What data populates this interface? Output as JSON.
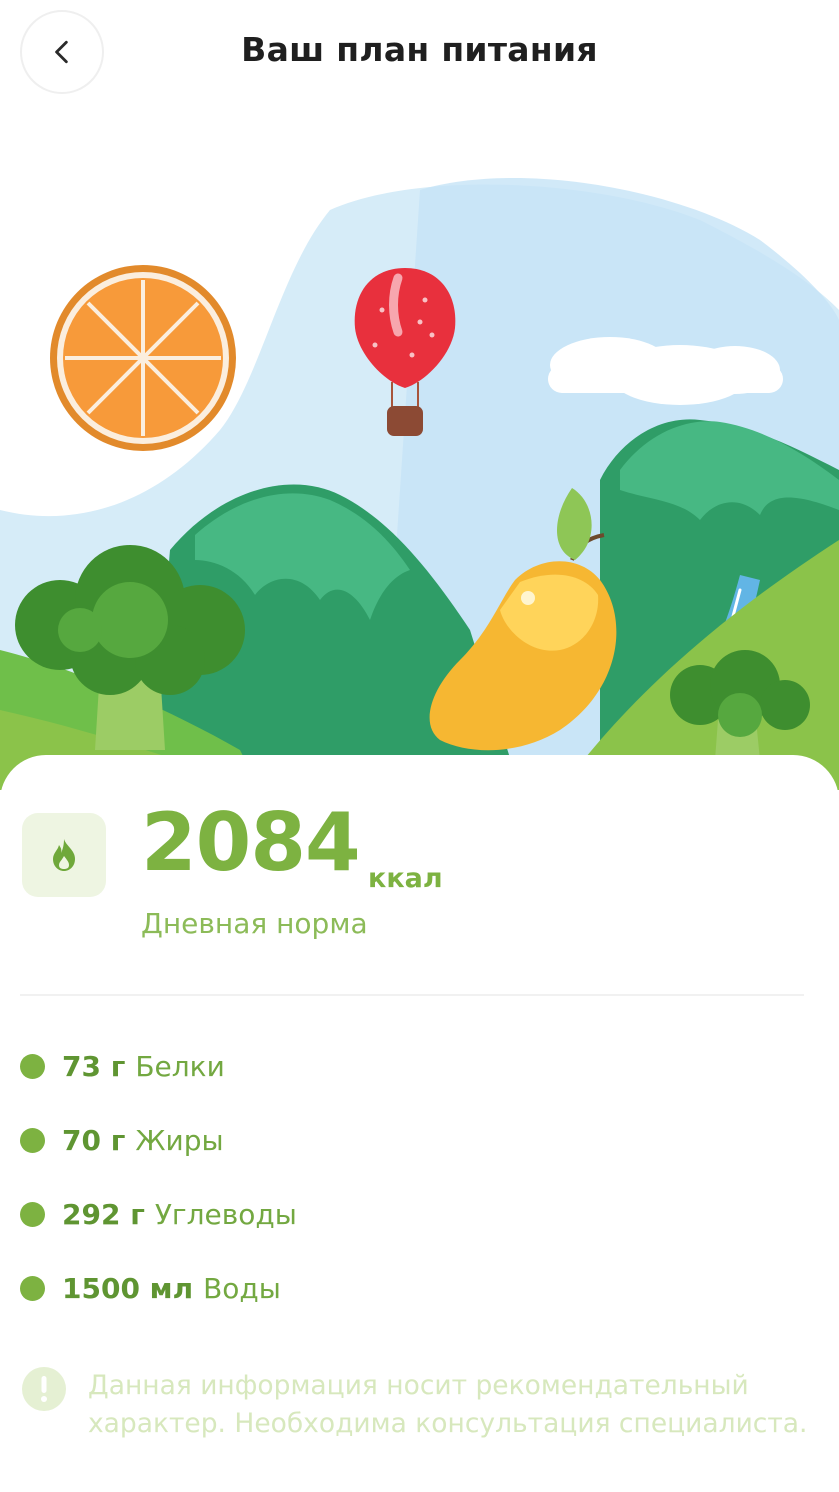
{
  "header": {
    "title": "Ваш план питания",
    "back_icon": "chevron-left-icon"
  },
  "summary": {
    "calories_value": "2084",
    "calories_unit": "ккал",
    "calories_label": "Дневная норма",
    "icon": "flame-icon"
  },
  "macros": [
    {
      "value": "73 г",
      "name": "Белки"
    },
    {
      "value": "70 г",
      "name": "Жиры"
    },
    {
      "value": "292 г",
      "name": "Углеводы"
    },
    {
      "value": "1500 мл",
      "name": "Воды"
    }
  ],
  "notice": {
    "icon": "exclamation-icon",
    "text": "Данная информация носит рекомендательный характер. Необходима консультация специалиста."
  },
  "colors": {
    "accent": "#7db241",
    "accent_light": "#eef5e2",
    "title": "#1f1f1f",
    "notice_text": "#d7e8bd"
  }
}
